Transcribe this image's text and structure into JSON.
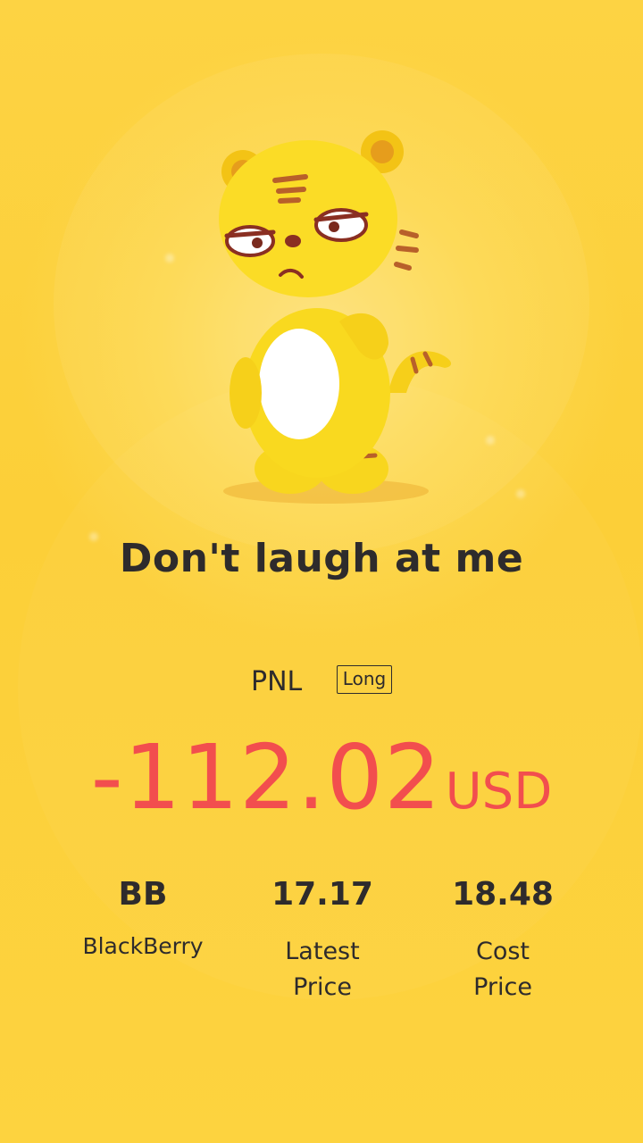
{
  "headline": "Don't laugh at me",
  "pnl": {
    "label": "PNL",
    "side": "Long",
    "value": "-112.02",
    "unit": "USD",
    "color": "#f24e4e"
  },
  "stats": [
    {
      "value": "BB",
      "label": "BlackBerry"
    },
    {
      "value": "17.17",
      "label_line1": "Latest",
      "label_line2": "Price"
    },
    {
      "value": "18.48",
      "label_line1": "Cost",
      "label_line2": "Price"
    }
  ],
  "mascot": {
    "icon": "tiger-mascot-icon"
  },
  "colors": {
    "background": "#fdd13a",
    "text": "#2e2b2c"
  }
}
